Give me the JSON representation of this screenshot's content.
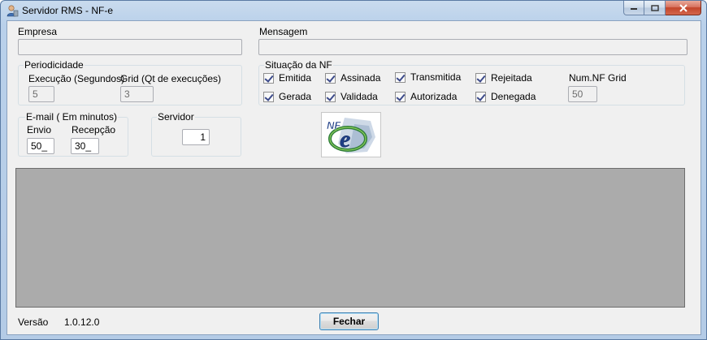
{
  "window": {
    "title": "Servidor RMS - NF-e"
  },
  "empresa": {
    "label": "Empresa",
    "value": ""
  },
  "mensagem": {
    "label": "Mensagem",
    "value": ""
  },
  "periodicidade": {
    "title": "Periodicidade",
    "execucao_label": "Execução (Segundos)",
    "execucao_value": "5",
    "grid_label": "Grid (Qt de execuções)",
    "grid_value": "3"
  },
  "situacao": {
    "title": "Situação da NF",
    "checkboxes": [
      {
        "label": "Emitida",
        "checked": true
      },
      {
        "label": "Assinada",
        "checked": true
      },
      {
        "label": "Transmitida",
        "checked": true
      },
      {
        "label": "Rejeitada",
        "checked": true
      },
      {
        "label": "Gerada",
        "checked": true
      },
      {
        "label": "Validada",
        "checked": true
      },
      {
        "label": "Autorizada",
        "checked": true
      },
      {
        "label": "Denegada",
        "checked": true
      }
    ],
    "num_nf_grid_label": "Num.NF Grid",
    "num_nf_grid_value": "50"
  },
  "email": {
    "title": "E-mail ( Em minutos)",
    "envio_label": "Envio",
    "envio_value": "50_",
    "recepcao_label": "Recepção",
    "recepcao_value": "30_"
  },
  "servidor": {
    "title": "Servidor",
    "value": "1"
  },
  "footer": {
    "versao_label": "Versão",
    "versao_value": "1.0.12.0",
    "fechar_label": "Fechar"
  },
  "icons": {
    "logo": "nfe-logo-icon",
    "app": "user-server-icon"
  }
}
